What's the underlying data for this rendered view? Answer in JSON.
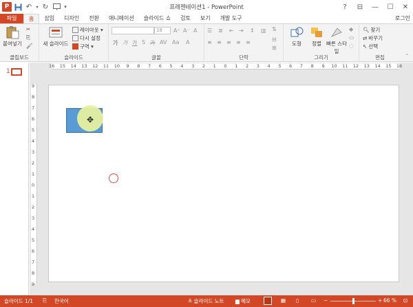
{
  "window": {
    "title": "프레젠테이션1 - PowerPoint",
    "login": "로그인",
    "controls": [
      "?",
      "⊟",
      "—",
      "☐",
      "✕"
    ]
  },
  "qat": {
    "save_icon": "save-icon",
    "undo_icon": "undo-icon",
    "redo_icon": "redo-icon",
    "slideshow_icon": "slideshow-icon"
  },
  "tabs": [
    {
      "label": "파일"
    },
    {
      "label": "홈"
    },
    {
      "label": "삽입"
    },
    {
      "label": "디자인"
    },
    {
      "label": "전환"
    },
    {
      "label": "애니메이션"
    },
    {
      "label": "슬라이드 쇼"
    },
    {
      "label": "검토"
    },
    {
      "label": "보기"
    },
    {
      "label": "개발 도구"
    }
  ],
  "ribbon": {
    "clipboard": {
      "paste": "붙여넣기",
      "label": "클립보드"
    },
    "slides": {
      "new_slide": "새 슬라이드",
      "layout": "레이아웃 ▾",
      "reset": "다시 설정",
      "section": "구역 ▾",
      "label": "슬라이드"
    },
    "font": {
      "size": "18",
      "label": "글꼴"
    },
    "paragraph": {
      "label": "단락"
    },
    "drawing": {
      "shape": "도형",
      "arrange": "정렬",
      "quick_styles": "빠른 스타일",
      "label": "그리기"
    },
    "editing": {
      "find": "찾기",
      "replace": "바꾸기",
      "select": "선택",
      "label": "편집"
    }
  },
  "thumbnail": {
    "number": "1"
  },
  "rulers": {
    "h_ticks": [
      "16",
      "15",
      "14",
      "13",
      "12",
      "11",
      "10",
      "9",
      "8",
      "7",
      "6",
      "5",
      "4",
      "3",
      "2",
      "1",
      "0",
      "1",
      "2",
      "3",
      "4",
      "5",
      "6",
      "7",
      "8",
      "9",
      "10",
      "11",
      "12",
      "13",
      "14",
      "15",
      "16"
    ],
    "v_ticks": [
      "9",
      "8",
      "7",
      "6",
      "5",
      "4",
      "3",
      "2",
      "1",
      "0",
      "1",
      "2",
      "3",
      "4",
      "5",
      "6",
      "7",
      "8",
      "9"
    ]
  },
  "statusbar": {
    "slide_info": "슬라이드 1/1",
    "language": "한국어",
    "notes": "슬라이드 노트",
    "comments": "메모",
    "zoom": "66 %",
    "zoom_level": 0.5
  },
  "colors": {
    "accent": "#d24726",
    "shape_fill": "#5b9bd5",
    "circle_fill": "#e6f0a0"
  }
}
